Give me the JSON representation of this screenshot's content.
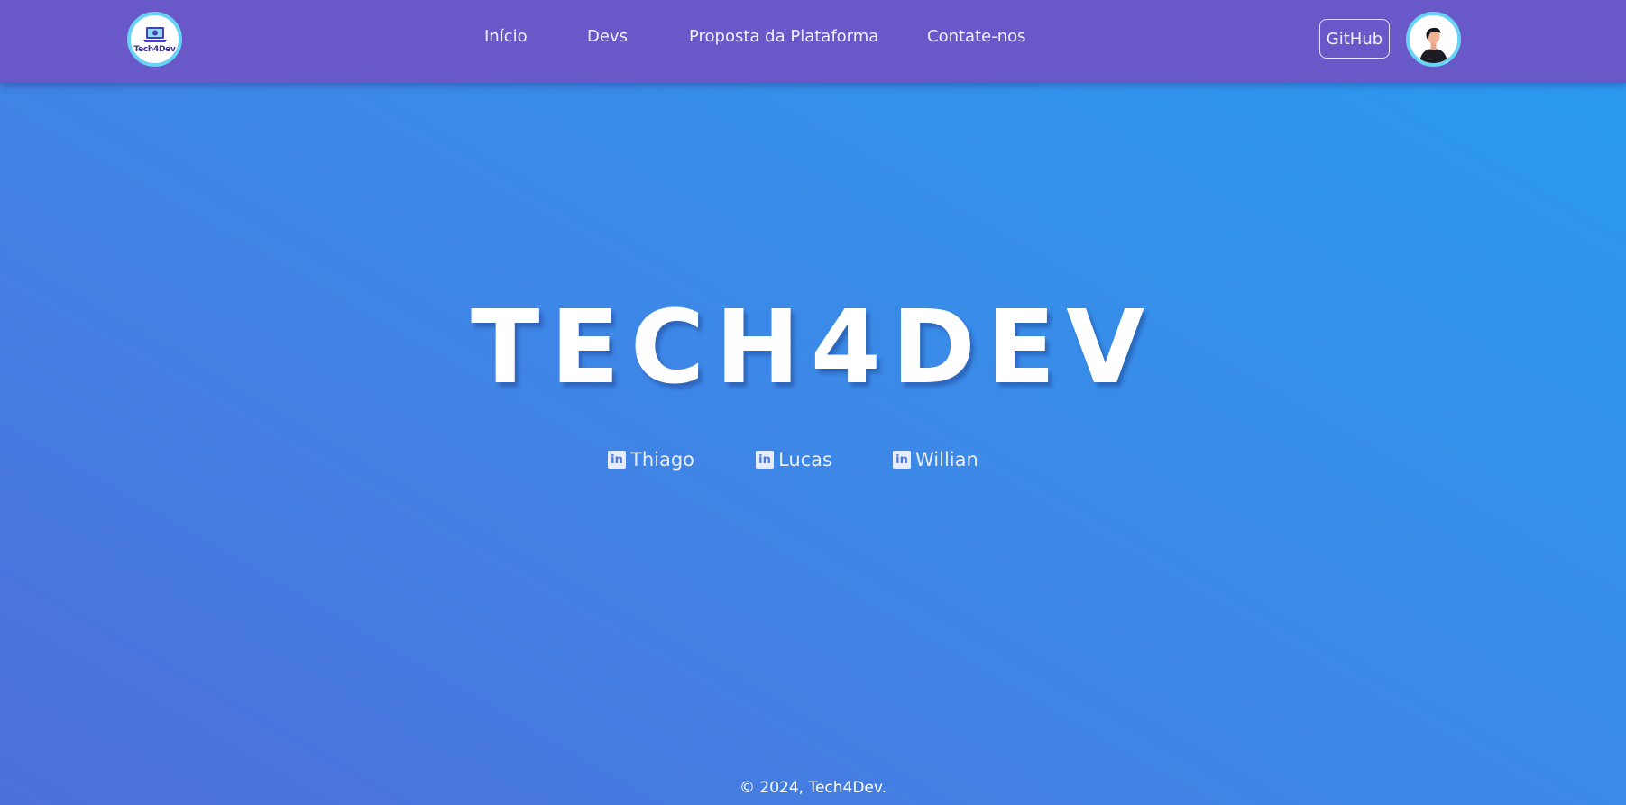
{
  "header": {
    "logo_text": "Tech4Dev",
    "nav": [
      {
        "label": "Início"
      },
      {
        "label": "Devs"
      },
      {
        "label": "Proposta da Plataforma"
      },
      {
        "label": "Contate-nos"
      }
    ],
    "github_label": "GitHub"
  },
  "hero": {
    "title": "TECH4DEV",
    "profiles": [
      {
        "icon": "linkedin-icon",
        "name": "Thiago"
      },
      {
        "icon": "linkedin-icon",
        "name": "Lucas"
      },
      {
        "icon": "linkedin-icon",
        "name": "Willian"
      }
    ]
  },
  "footer": {
    "copyright": "© 2024, Tech4Dev."
  },
  "colors": {
    "navbar": "#6858c8",
    "accent_ring": "#6ad2f5",
    "gradient_start": "#4e70da",
    "gradient_end": "#2b9bef"
  }
}
